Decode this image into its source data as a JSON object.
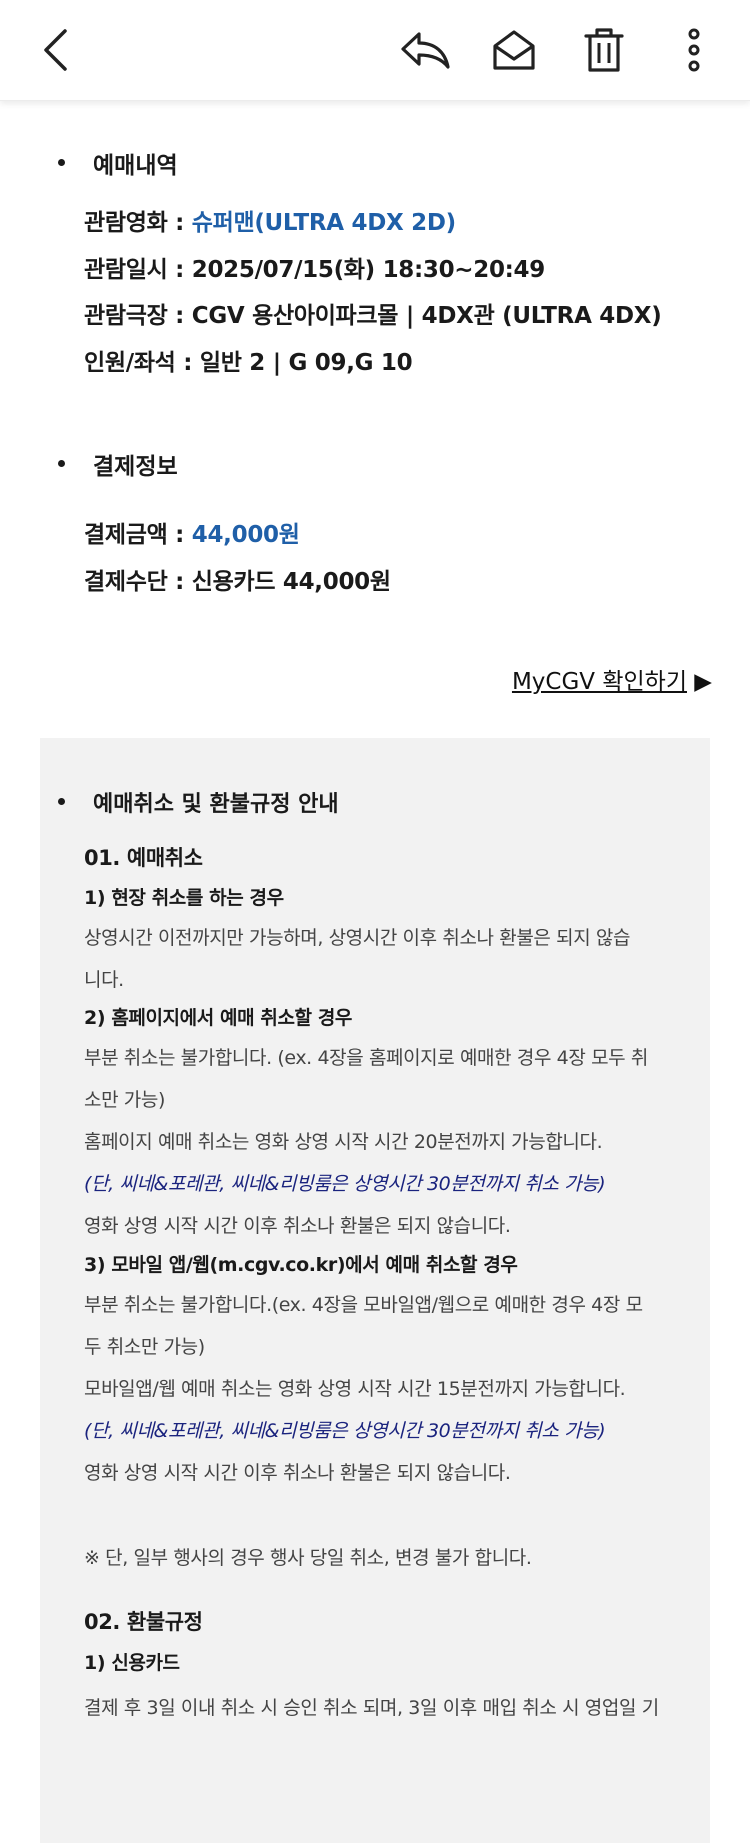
{
  "toolbar": {
    "back_icon": "back-arrow-icon",
    "reply_icon": "reply-icon",
    "mail_icon": "open-mail-icon",
    "delete_icon": "trash-icon",
    "more_icon": "more-vertical-icon"
  },
  "booking": {
    "heading": "예매내역",
    "movie_label": "관람영화 : ",
    "movie_value": "슈퍼맨(ULTRA 4DX 2D)",
    "datetime": "관람일시 : 2025/07/15(화) 18:30~20:49",
    "theater": "관람극장 : CGV 용산아이파크몰 | 4DX관 (ULTRA 4DX)",
    "seats": "인원/좌석 : 일반 2 | G 09,G 10"
  },
  "payment": {
    "heading": "결제정보",
    "amount_label": "결제금액 : ",
    "amount_value": "44,000원",
    "method": "결제수단 : 신용카드 44,000원"
  },
  "mycgv_link": {
    "label": "MyCGV 확인하기",
    "arrow": "▶"
  },
  "policy": {
    "heading": "예매취소 및 환불규정 안내",
    "s1": "01. 예매취소",
    "s1_1": "1) 현장 취소를 하는 경우",
    "t1": "상영시간 이전까지만 가능하며, 상영시간 이후 취소나 환불은 되지 않습",
    "t2": "니다.",
    "s1_2": "2) 홈페이지에서 예매 취소할 경우",
    "t3": "부분 취소는 불가합니다. (ex. 4장을 홈페이지로 예매한 경우 4장 모두 취",
    "t4": "소만 가능)",
    "t5": "홈페이지 예매 취소는 영화 상영 시작 시간 20분전까지 가능합니다.",
    "t6": "(단, 씨네&포레관, 씨네&리빙룸은 상영시간 30분전까지 취소 가능)",
    "t7": "영화 상영 시작 시간 이후 취소나 환불은 되지 않습니다.",
    "s1_3": "3) 모바일 앱/웹(m.cgv.co.kr)에서 예매 취소할 경우",
    "t8": "부분 취소는 불가합니다.(ex. 4장을 모바일앱/웹으로 예매한 경우 4장 모",
    "t9": "두 취소만 가능)",
    "t10": "모바일앱/웹 예매 취소는 영화 상영 시작 시간 15분전까지 가능합니다.",
    "t11": "(단, 씨네&포레관, 씨네&리빙룸은 상영시간 30분전까지 취소 가능)",
    "t12": "영화 상영 시작 시간 이후 취소나 환불은 되지 않습니다.",
    "t13": "※ 단, 일부 행사의 경우 행사 당일 취소, 변경 불가 합니다.",
    "s2": "02. 환불규정",
    "s2_1": "1) 신용카드",
    "t14": "결제 후 3일 이내 취소 시 승인 취소 되며, 3일 이후 매입 취소 시 영업일 기"
  }
}
